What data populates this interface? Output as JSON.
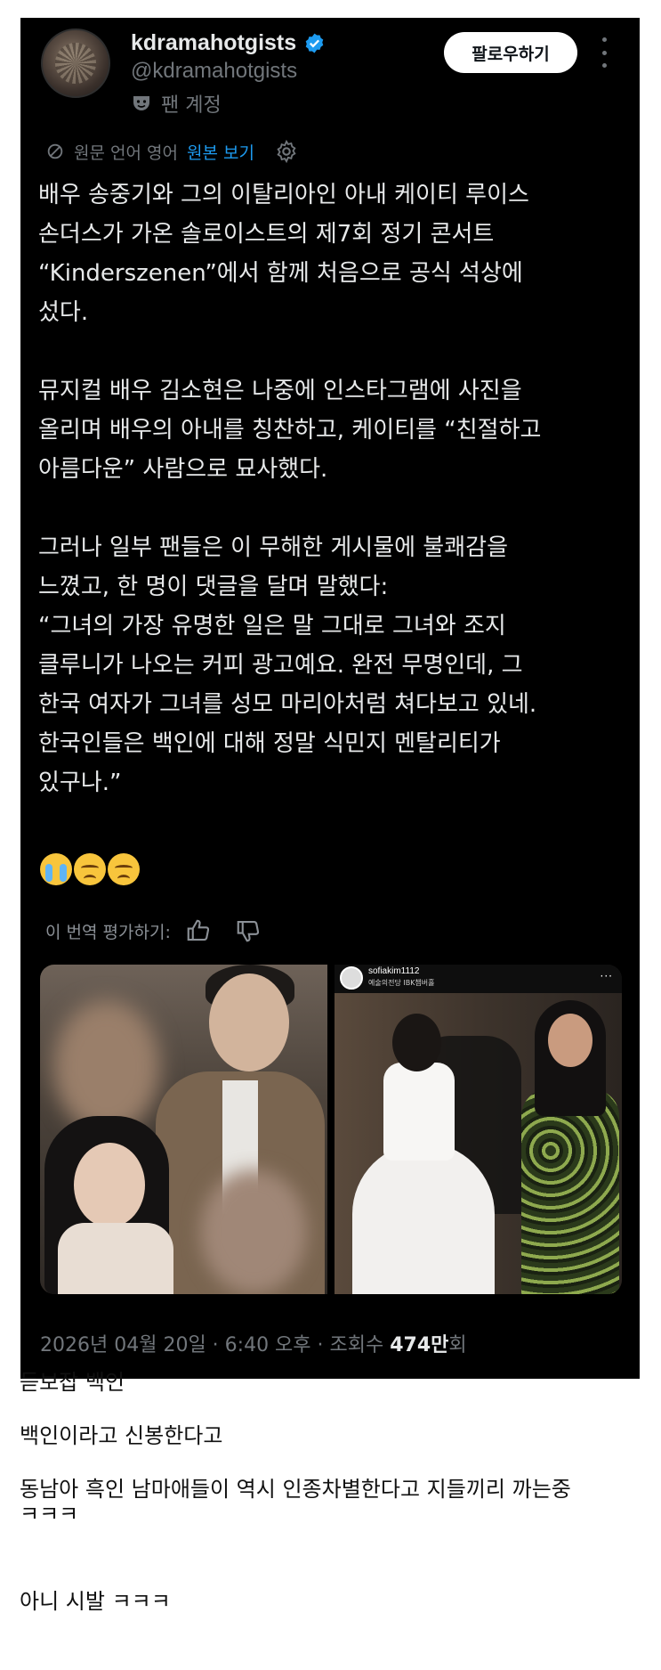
{
  "tweet": {
    "display_name": "kdramahotgists",
    "handle": "@kdramahotgists",
    "fan_label": "팬 계정",
    "follow_label": "팔로우하기",
    "translation_note": "원문 언어 영어",
    "show_original": "원본 보기",
    "body": [
      [
        "배우 송중기와 그의 이탈리아인 아내 케이티 루이스",
        "손더스가 가온 솔로이스트의 제7회 정기 콘서트",
        "“Kinderszenen”에서 함께 처음으로 공식 석상에",
        "섰다."
      ],
      [
        "뮤지컬 배우 김소현은 나중에 인스타그램에 사진을",
        "올리며 배우의 아내를 칭찬하고, 케이티를 “친절하고",
        "아름다운” 사람으로 묘사했다."
      ],
      [
        "그러나 일부 팬들은 이 무해한 게시물에 불쾌감을",
        "느꼈고, 한 명이 댓글을 달며 말했다:",
        "“그녀의 가장 유명한 일은 말 그대로 그녀와 조지",
        "클루니가 나오는 커피 광고예요. 완전 무명인데, 그",
        "한국 여자가 그녀를 성모 마리아처럼 쳐다보고 있네.",
        "한국인들은 백인에 대해 정말 식민지 멘탈리티가",
        "있구나.”"
      ]
    ],
    "emojis": [
      "loudly-crying-face",
      "unamused-face",
      "unamused-face"
    ],
    "rate_label": "이 번역 평가하기:",
    "instagram_user": "sofiakim1112",
    "instagram_sub": "예술의전당 IBK챔버홀",
    "instagram_more": "···",
    "date_text": "2026년 04월 20일 · 6:40 오후 · 조회수",
    "views_count": "474만",
    "views_suffix": "회",
    "colors": {
      "background": "#000000",
      "link": "#1d9bf0",
      "muted": "#71767b",
      "text": "#e7e9ea"
    }
  },
  "comments": [
    {
      "text": "듣보잡 백인"
    },
    {
      "text": "백인이라고 신봉한다고"
    },
    {
      "text": "동남아 흑인 남마애들이 역시 인종차별한다고 지들끼리 까는중"
    },
    {
      "text": "ㅋㅋㅋ"
    },
    {
      "text": "아니 시발 ㅋㅋㅋ"
    }
  ]
}
